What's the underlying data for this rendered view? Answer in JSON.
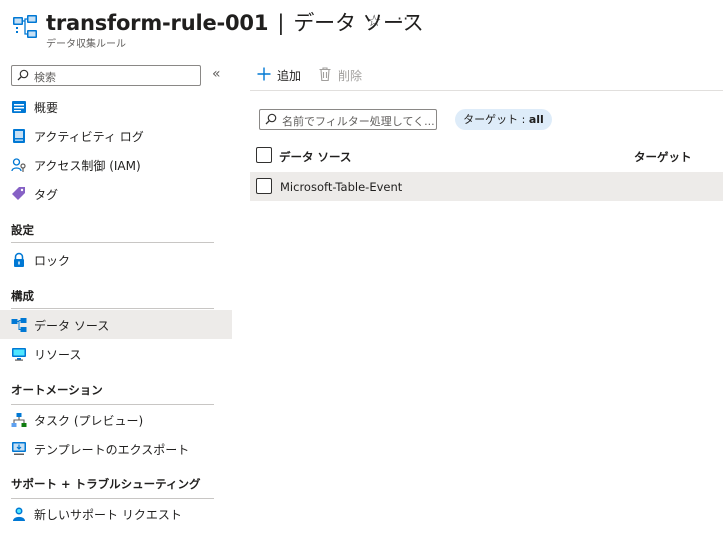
{
  "header": {
    "resource_name": "transform-rule-001",
    "separator": "|",
    "page_name": "データ ソース",
    "subtitle": "データ収集ルール",
    "favorite_icon": "star-outline-icon",
    "more_icon": "ellipsis-icon",
    "more_label": "···"
  },
  "sidebar": {
    "search_placeholder": "検索",
    "collapse_label": "«",
    "items_top": [
      {
        "label": "概要",
        "icon": "overview-icon"
      },
      {
        "label": "アクティビティ ログ",
        "icon": "activity-log-icon"
      },
      {
        "label": "アクセス制御 (IAM)",
        "icon": "iam-icon"
      },
      {
        "label": "タグ",
        "icon": "tag-icon"
      }
    ],
    "sections": [
      {
        "title": "設定",
        "items": [
          {
            "label": "ロック",
            "icon": "lock-icon"
          }
        ]
      },
      {
        "title": "構成",
        "items": [
          {
            "label": "データ ソース",
            "icon": "data-sources-icon",
            "selected": true
          },
          {
            "label": "リソース",
            "icon": "resources-icon"
          }
        ]
      },
      {
        "title": "オートメーション",
        "items": [
          {
            "label": "タスク (プレビュー)",
            "icon": "tasks-icon"
          },
          {
            "label": "テンプレートのエクスポート",
            "icon": "export-template-icon"
          }
        ]
      },
      {
        "title": "サポート + トラブルシューティング",
        "items": [
          {
            "label": "新しいサポート リクエスト",
            "icon": "support-request-icon"
          }
        ]
      }
    ]
  },
  "toolbar": {
    "add_label": "追加",
    "delete_label": "削除"
  },
  "filter": {
    "placeholder": "名前でフィルター処理してく...",
    "pill_label": "ターゲット : ",
    "pill_value": "all"
  },
  "table": {
    "columns": [
      "データ ソース",
      "ターゲット"
    ],
    "rows": [
      {
        "name": "Microsoft-Table-Event",
        "target": ""
      }
    ]
  },
  "colors": {
    "accent": "#0078d4",
    "selected_bg": "#edebe9",
    "pill_bg": "#deecf9"
  }
}
